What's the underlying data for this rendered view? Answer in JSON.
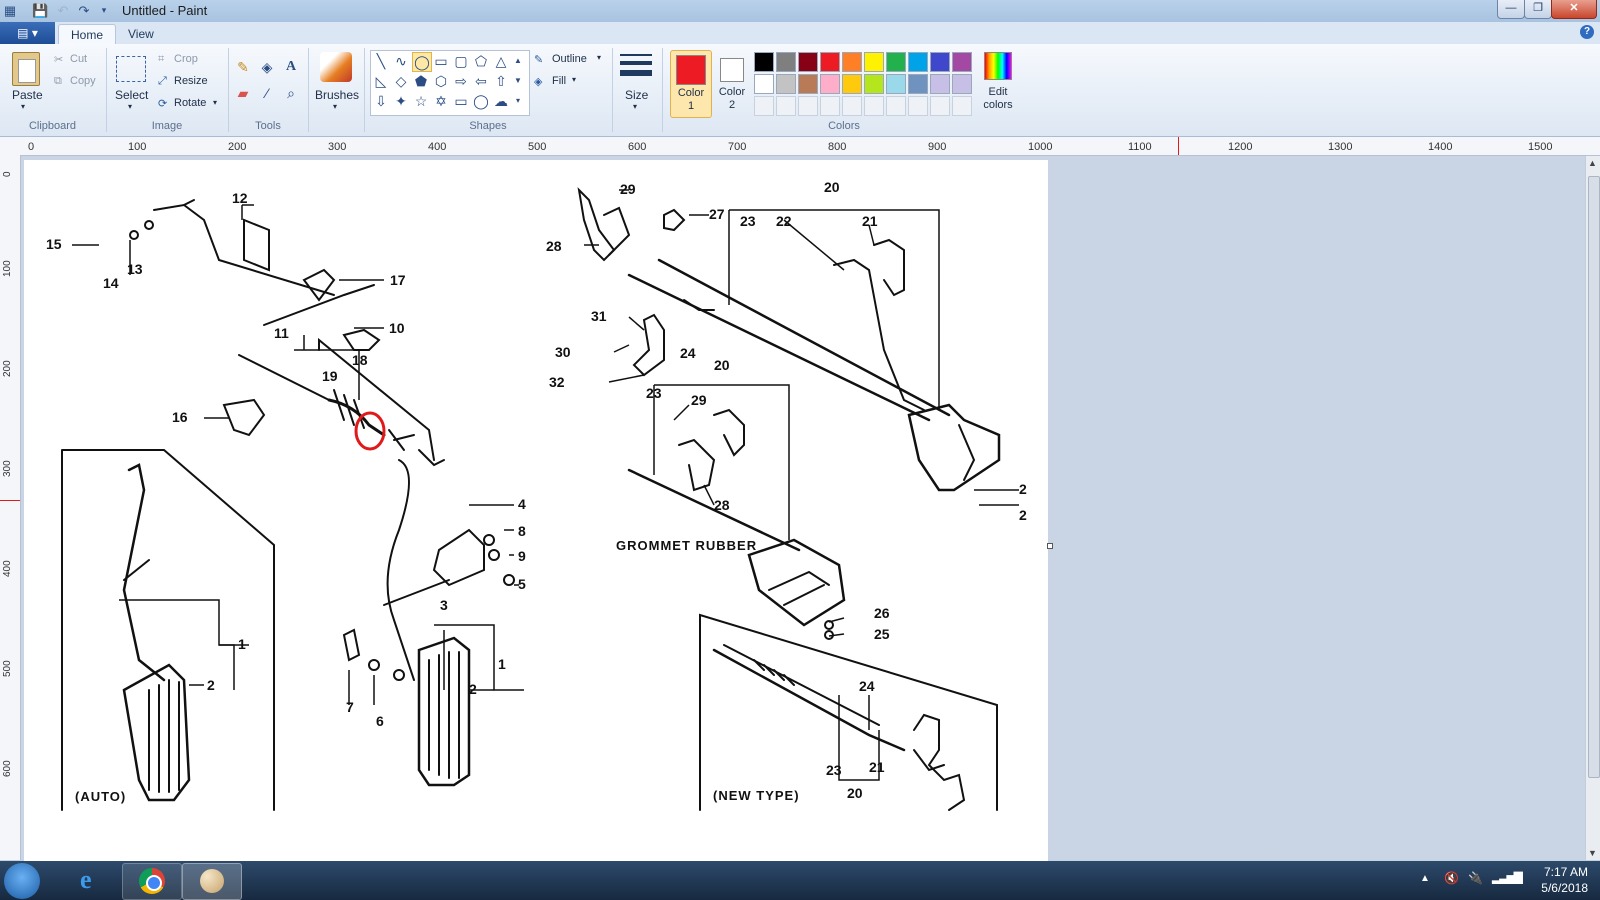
{
  "window": {
    "title": "Untitled - Paint",
    "minimize": "—",
    "maximize": "❐",
    "close": "✕"
  },
  "tabs": {
    "app_menu": "▤ ▾",
    "home": "Home",
    "view": "View",
    "help": "?"
  },
  "clipboard": {
    "paste": "Paste",
    "cut": "Cut",
    "copy": "Copy",
    "label": "Clipboard"
  },
  "image": {
    "select": "Select",
    "crop": "Crop",
    "resize": "Resize",
    "rotate": "Rotate",
    "label": "Image"
  },
  "tools": {
    "label": "Tools"
  },
  "brushes": {
    "label": "Brushes"
  },
  "shapes": {
    "outline": "Outline",
    "fill": "Fill",
    "label": "Shapes"
  },
  "size": {
    "label": "Size"
  },
  "colors": {
    "color1_line1": "Color",
    "color1_line2": "1",
    "color2_line1": "Color",
    "color2_line2": "2",
    "edit_line1": "Edit",
    "edit_line2": "colors",
    "label": "Colors",
    "color1": "#ed1c24",
    "color2": "#ffffff",
    "palette_row1": [
      "#000000",
      "#7f7f7f",
      "#880015",
      "#ed1c24",
      "#ff7f27",
      "#fff200",
      "#22b14c",
      "#00a2e8",
      "#3f48cc",
      "#a349a4"
    ],
    "palette_row2": [
      "#ffffff",
      "#c3c3c3",
      "#b97a57",
      "#ffaec9",
      "#ffc90e",
      "#b5e61d",
      "#99d9ea",
      "#7092be",
      "#c8bfe7",
      "#c8bfe7"
    ]
  },
  "ruler": {
    "h": [
      "0",
      "100",
      "200",
      "300",
      "400",
      "500",
      "600",
      "700",
      "800",
      "900",
      "1000",
      "1100",
      "1200",
      "1300",
      "1400",
      "1500"
    ],
    "v": [
      "0",
      "100",
      "200",
      "300",
      "400",
      "500",
      "600"
    ]
  },
  "diagram": {
    "part_labels": [
      "1",
      "2",
      "3",
      "4",
      "5",
      "6",
      "7",
      "8",
      "9",
      "10",
      "11",
      "12",
      "13",
      "14",
      "15",
      "16",
      "17",
      "18",
      "19",
      "20",
      "21",
      "22",
      "23",
      "24",
      "25",
      "26",
      "27",
      "28",
      "29",
      "30",
      "31",
      "32"
    ],
    "grommet": "GROMMET RUBBER",
    "auto": "(AUTO)",
    "new_type": "(NEW TYPE)"
  },
  "taskbar": {
    "time": "7:17 AM",
    "date": "5/6/2018"
  }
}
